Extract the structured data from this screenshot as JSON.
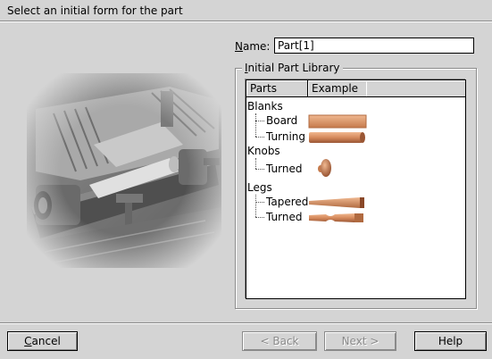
{
  "header": {
    "title": "Select an initial form for the part"
  },
  "name_field": {
    "label_prefix": "N",
    "label_rest": "ame:",
    "value": "Part[1]"
  },
  "library": {
    "group_title_prefix": "I",
    "group_title_rest": "nitial Part Library",
    "columns": [
      "Parts",
      "Example"
    ],
    "groups": [
      {
        "label": "Blanks",
        "items": [
          {
            "label": "Board"
          },
          {
            "label": "Turning"
          }
        ]
      },
      {
        "label": "Knobs",
        "items": [
          {
            "label": "Turned"
          }
        ]
      },
      {
        "label": "Legs",
        "items": [
          {
            "label": "Tapered"
          },
          {
            "label": "Turned"
          }
        ]
      }
    ]
  },
  "buttons": {
    "cancel": {
      "prefix": "C",
      "rest": "ancel"
    },
    "back": {
      "text": "< Back"
    },
    "next": {
      "text": "Next >"
    },
    "help": {
      "text": "Help"
    }
  },
  "colors": {
    "wood": "#d68a5c",
    "wood_dark": "#9a5634",
    "wood_light": "#f0b890"
  }
}
